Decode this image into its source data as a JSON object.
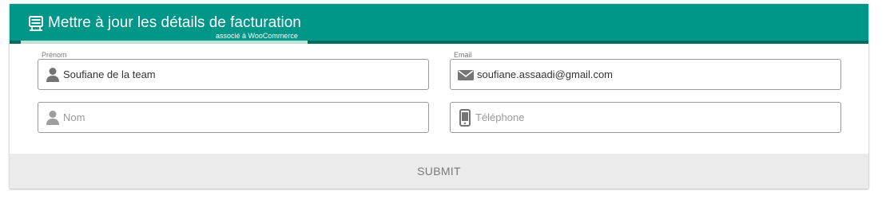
{
  "header": {
    "title": "Mettre à jour les détails de facturation",
    "subtitle": "associé à WooCommerce",
    "icon": "billing-icon"
  },
  "form": {
    "first_name": {
      "label": "Prénom",
      "value": "Soufiane de la team",
      "icon": "user-icon"
    },
    "email": {
      "label": "Email",
      "value": "soufiane.assaadi@gmail.com",
      "icon": "envelope-icon"
    },
    "last_name": {
      "placeholder": "Nom",
      "icon": "user-icon"
    },
    "phone": {
      "placeholder": "Téléphone",
      "icon": "mobile-phone-icon"
    }
  },
  "submit_label": "SUBMIT",
  "colors": {
    "header_bg": "#009688",
    "header_underline": "#006b5f",
    "submit_bg": "#ebebeb",
    "border": "#9a9a9a",
    "icon": "#757575"
  }
}
